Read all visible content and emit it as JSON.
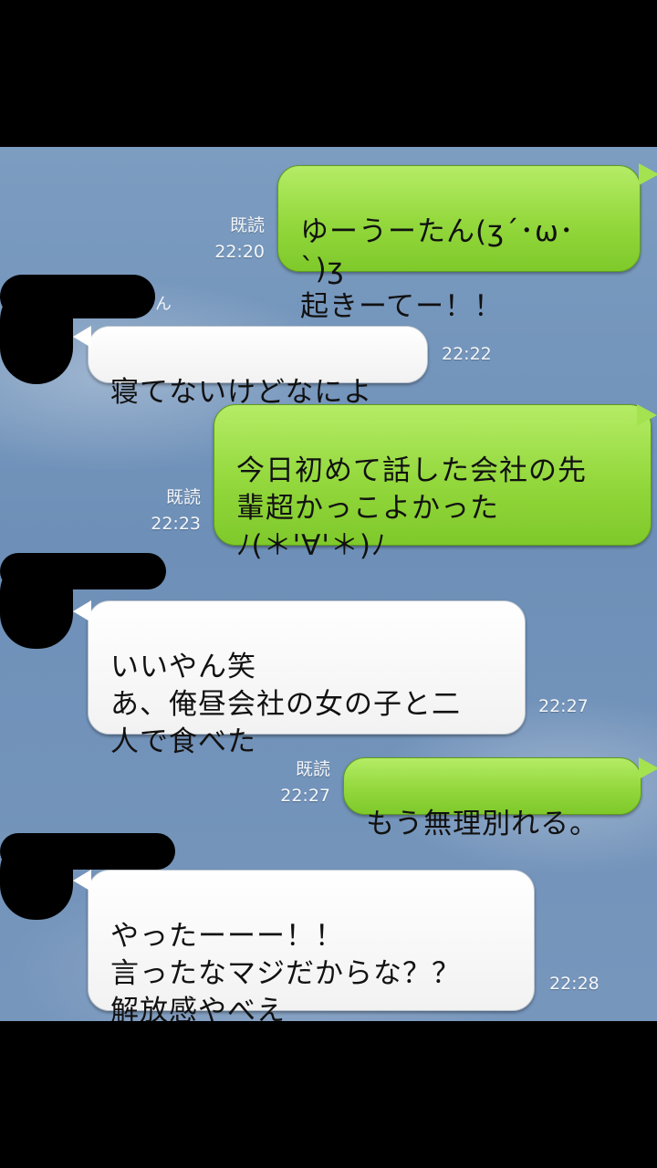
{
  "messages": [
    {
      "side": "out",
      "read": "既読",
      "time": "22:20",
      "text": "ゆーうーたん(ʒ´･ω･`)ʒ\n起きーてー！！"
    },
    {
      "side": "in",
      "time": "22:22",
      "text": "寝てないけどなによ"
    },
    {
      "side": "out",
      "read": "既読",
      "time": "22:23",
      "text": "今日初めて話した会社の先\n輩超かっこよかった\nﾉ(＊'∀'＊)ﾉ"
    },
    {
      "side": "in",
      "time": "22:27",
      "text": "いいやん笑\nあ、俺昼会社の女の子と二\n人で食べた"
    },
    {
      "side": "out",
      "read": "既読",
      "time": "22:27",
      "text": "もう無理別れる。"
    },
    {
      "side": "in",
      "time": "22:28",
      "text": "やったーーー！！\n言ったなマジだからな？？\n解放感やべえ"
    }
  ],
  "sender_name_fragment": "ん",
  "colors": {
    "outgoing_bubble": "#93d83c",
    "incoming_bubble": "#ffffff",
    "background": "#6e90b8",
    "letterbox": "#000000"
  }
}
